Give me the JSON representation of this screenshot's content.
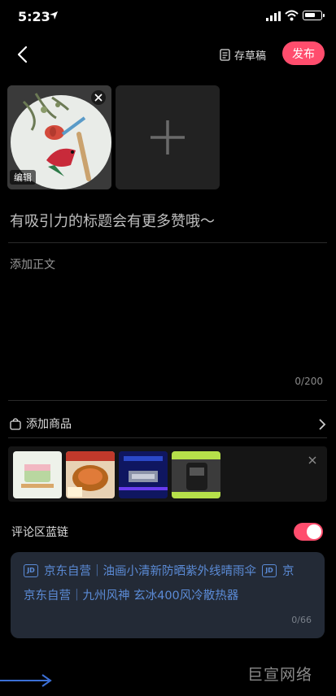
{
  "status_bar": {
    "time": "5:23"
  },
  "nav": {
    "draft_label": "存草稿",
    "publish_label": "发布"
  },
  "media": {
    "edit_label": "编辑"
  },
  "title_placeholder": "有吸引力的标题会有更多赞哦～",
  "body_placeholder": "添加正文",
  "char_count": "0/200",
  "product": {
    "label": "添加商品"
  },
  "comment": {
    "label": "评论区蓝链",
    "enabled": true
  },
  "links": {
    "items": [
      "京东自营｜油画小清新防晒紫外线晴雨伞",
      "京东自营｜九州风神 玄冰400风冷散热器"
    ],
    "trailing": "京",
    "badge": "JD",
    "count": "0/66"
  },
  "watermark": "巨宣网络",
  "colors": {
    "accent": "#ff4d6d",
    "link": "#5b8bd6"
  }
}
